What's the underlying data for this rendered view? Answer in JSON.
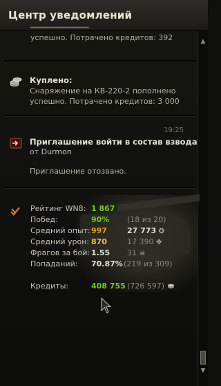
{
  "header": {
    "title": "Центр уведомлений"
  },
  "notifications": {
    "partial": {
      "line": "успешно. Потрачено кредитов:  392"
    },
    "bought": {
      "title": "Куплено:",
      "line1": "Снаряжение на КВ-220-2 пополнено",
      "line2": "успешно. Потрачено кредитов:  3 000"
    },
    "invite": {
      "time": "19:25",
      "title": "Приглашение войти в состав взвода",
      "from_prefix": "от",
      "from_name": "Durmon",
      "status": "Приглашение отозвано."
    }
  },
  "stats": {
    "rows": [
      {
        "label": "Рейтинг WN8:",
        "value": "1 867",
        "value_color": "#6ecb33",
        "extra": "",
        "extra_bold": "",
        "symbol": ""
      },
      {
        "label": "Побед:",
        "value": "90%",
        "value_color": "#6ecb33",
        "extra": "(18 из 20)",
        "extra_bold": "",
        "symbol": ""
      },
      {
        "label": "Средний опыт:",
        "value": "997",
        "value_color": "#e49a2b",
        "extra": "",
        "extra_bold": "27 773",
        "symbol": "✪"
      },
      {
        "label": "Средний урон:",
        "value": "870",
        "value_color": "#e4c73f",
        "extra": "17 390",
        "extra_bold": "",
        "symbol": "✥"
      },
      {
        "label": "Фрагов за бой:",
        "value": "1.55",
        "value_color": "#e3dfd3",
        "extra": "31",
        "extra_bold": "",
        "symbol": "☠"
      },
      {
        "label": "Попаданий:",
        "value": "70.87%",
        "value_color": "#e3dfd3",
        "extra": "(219 из 309)",
        "extra_bold": "",
        "symbol": ""
      }
    ],
    "credits": {
      "label": "Кредиты:",
      "value": "408 755",
      "extra": "(726 597)",
      "symbol": "credits-icon"
    }
  },
  "icons": {
    "bought_icon": "coins-stack-icon",
    "invite_icon": "platoon-invite-icon",
    "battle_icon": "battle-result-icon"
  }
}
